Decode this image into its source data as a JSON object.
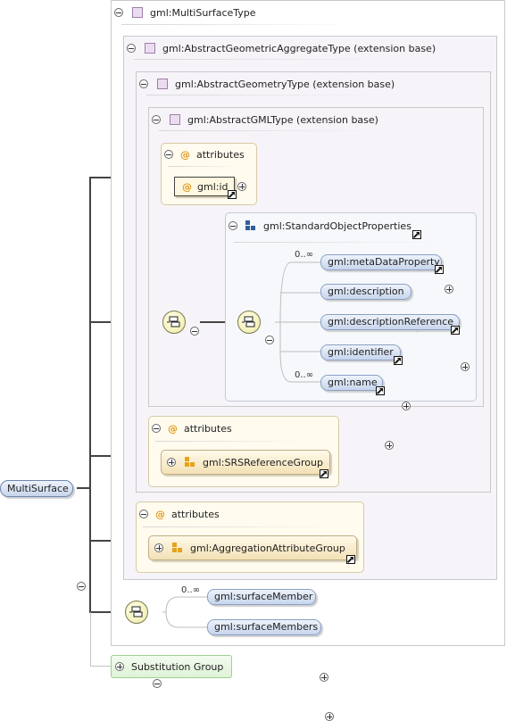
{
  "root": {
    "label": "MultiSurface"
  },
  "types": {
    "multi_surface": "gml:MultiSurfaceType",
    "aggregate": "gml:AbstractGeometricAggregateType (extension base)",
    "geometry": "gml:AbstractGeometryType (extension base)",
    "gml": "gml:AbstractGMLType (extension base)"
  },
  "attributes_label": "attributes",
  "attr_symbol": "@",
  "id_attr": "gml:id",
  "standard_group": {
    "label": "gml:StandardObjectProperties",
    "elements": [
      {
        "label": "gml:metaDataProperty",
        "cardinality": "0..∞"
      },
      {
        "label": "gml:description",
        "cardinality": ""
      },
      {
        "label": "gml:descriptionReference",
        "cardinality": ""
      },
      {
        "label": "gml:identifier",
        "cardinality": ""
      },
      {
        "label": "gml:name",
        "cardinality": "0..∞"
      }
    ]
  },
  "srs_group": "gml:SRSReferenceGroup",
  "aggregation_group": "gml:AggregationAttributeGroup",
  "members": [
    {
      "label": "gml:surfaceMember",
      "cardinality": "0..∞"
    },
    {
      "label": "gml:surfaceMembers",
      "cardinality": ""
    }
  ],
  "substitution_group": "Substitution Group",
  "colors": {
    "element_fill": "#c7d5ec",
    "attribute_fill": "#fff7df",
    "substitution_fill": "#e8f7e2"
  }
}
